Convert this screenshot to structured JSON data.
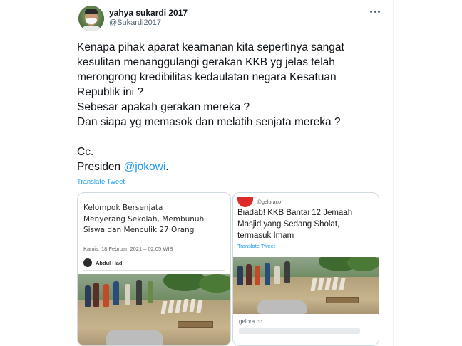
{
  "author": {
    "display_name": "yahya sukardi 2017",
    "handle": "@Sukardi2017"
  },
  "tweet": {
    "lines": [
      "Kenapa pihak aparat keamanan kita sepertinya sangat",
      "kesulitan menanggulangi gerakan KKB yg jelas telah",
      "merongrong kredibilitas kedaulatan negara Kesatuan",
      "Republik ini ?",
      "Sebesar apakah gerakan mereka ?",
      "Dan siapa yg memasok dan melatih senjata mereka ?"
    ],
    "cc_line": "Cc.",
    "president_prefix": "Presiden ",
    "mention": "@jokowi",
    "president_suffix": ".",
    "translate_label": "Translate Tweet"
  },
  "card_left": {
    "headline_lines": [
      "Kelompok Bersenjata",
      "Menyerang Sekolah, Membunuh",
      "Siswa dan Menculik 27 Orang"
    ],
    "dateline": "Kamis, 18 Februari 2021 – 02:05 WIB",
    "author": "Abdul Hadi"
  },
  "card_right": {
    "source": "@geloraco",
    "headline_lines": [
      "Biadab! KKB Bantai 12 Jemaah",
      "Masjid yang Sedang Sholat,",
      "termasuk Imam"
    ],
    "translate_label": "Translate Tweet",
    "domain": "gelora.co"
  },
  "colors": {
    "link": "#1d9bf0",
    "text": "#0f1419",
    "muted": "#536471"
  },
  "icons": {
    "more": "more-horizontal-icon"
  }
}
